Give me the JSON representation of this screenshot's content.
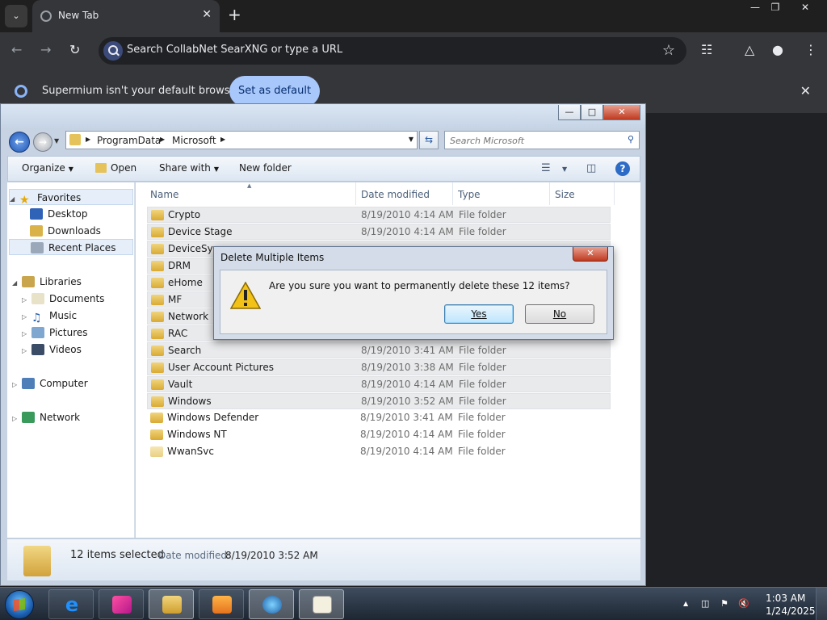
{
  "browser": {
    "tab_title": "New Tab",
    "new_tab": "+",
    "omnibox_text": "Search CollabNet SearXNG or type a URL",
    "infobar_message": "Supermium isn't your default browser",
    "infobar_button": "Set as default"
  },
  "explorer": {
    "breadcrumb": [
      "ProgramData",
      "Microsoft"
    ],
    "search_placeholder": "Search Microsoft",
    "commands": {
      "organize": "Organize",
      "open": "Open",
      "share_with": "Share with",
      "new_folder": "New folder"
    },
    "nav": {
      "favorites": "Favorites",
      "desktop": "Desktop",
      "downloads": "Downloads",
      "recent_places": "Recent Places",
      "libraries": "Libraries",
      "documents": "Documents",
      "music": "Music",
      "pictures": "Pictures",
      "videos": "Videos",
      "computer": "Computer",
      "network": "Network"
    },
    "columns": {
      "name": "Name",
      "date": "Date modified",
      "type": "Type",
      "size": "Size"
    },
    "files": [
      {
        "name": "Crypto",
        "date": "8/19/2010 4:14 AM",
        "type": "File folder",
        "selected": true
      },
      {
        "name": "Device Stage",
        "date": "8/19/2010 4:14 AM",
        "type": "File folder",
        "selected": true
      },
      {
        "name": "DeviceSync",
        "date": "",
        "type": "",
        "selected": true
      },
      {
        "name": "DRM",
        "date": "",
        "type": "",
        "selected": true
      },
      {
        "name": "eHome",
        "date": "",
        "type": "",
        "selected": true
      },
      {
        "name": "MF",
        "date": "",
        "type": "",
        "selected": true
      },
      {
        "name": "Network",
        "date": "",
        "type": "",
        "selected": true
      },
      {
        "name": "RAC",
        "date": "",
        "type": "",
        "selected": true
      },
      {
        "name": "Search",
        "date": "8/19/2010 3:41 AM",
        "type": "File folder",
        "selected": true
      },
      {
        "name": "User Account Pictures",
        "date": "8/19/2010 3:38 AM",
        "type": "File folder",
        "selected": true
      },
      {
        "name": "Vault",
        "date": "8/19/2010 4:14 AM",
        "type": "File folder",
        "selected": true
      },
      {
        "name": "Windows",
        "date": "8/19/2010 3:52 AM",
        "type": "File folder",
        "selected": true
      },
      {
        "name": "Windows Defender",
        "date": "8/19/2010 3:41 AM",
        "type": "File folder",
        "selected": false
      },
      {
        "name": "Windows NT",
        "date": "8/19/2010 4:14 AM",
        "type": "File folder",
        "selected": false
      },
      {
        "name": "WwanSvc",
        "date": "8/19/2010 4:14 AM",
        "type": "File folder",
        "selected": false
      }
    ],
    "details": {
      "selected_count": "12 items selected",
      "date_label": "Date modified:",
      "date_value": "8/19/2010 3:52 AM"
    }
  },
  "dialog": {
    "title": "Delete Multiple Items",
    "message": "Are you sure you want to permanently delete these 12 items?",
    "yes_label": "Yes",
    "no_label": "No"
  },
  "taskbar": {
    "apps": [
      "internet-explorer",
      "app-pink",
      "windows-explorer",
      "media-player",
      "browser-globe",
      "tiff-viewer"
    ],
    "time": "1:03 AM",
    "date": "1/24/2025"
  }
}
